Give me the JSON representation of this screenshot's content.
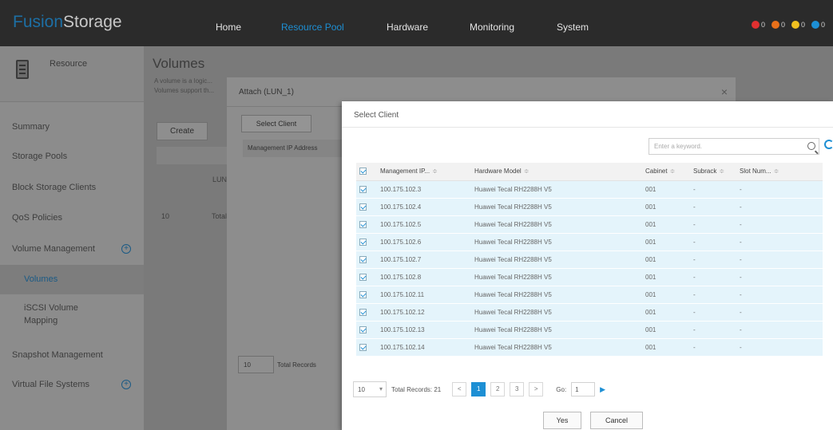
{
  "brand": {
    "logo_part1": "Fusion",
    "logo_part2": "Storage"
  },
  "nav": {
    "items": [
      "Home",
      "Resource Pool",
      "Hardware",
      "Monitoring",
      "System"
    ],
    "active": "Resource Pool"
  },
  "alarms": [
    {
      "color": "#e03030",
      "count": "0"
    },
    {
      "color": "#e8701a",
      "count": "0"
    },
    {
      "color": "#f0c020",
      "count": "0"
    },
    {
      "color": "#1d8fd4",
      "count": "0"
    }
  ],
  "sidebar": {
    "title": "Resource",
    "items": [
      "Summary",
      "Storage Pools",
      "Block Storage Clients",
      "QoS Policies",
      "Volume Management",
      "Volumes",
      "iSCSI Volume",
      "Mapping",
      "Snapshot Management",
      "Virtual File Systems"
    ]
  },
  "main": {
    "title": "Volumes",
    "desc_line1": "A volume is a logic...",
    "desc_line2": "Volumes support th...",
    "create_label": "Create",
    "row_text": "LUN",
    "page_size": "10",
    "total_text": "Total"
  },
  "attach": {
    "title": "Attach (LUN_1)",
    "close": "×",
    "select_client_label": "Select Client",
    "col_header": "Management IP Address",
    "page_size": "10",
    "total_text": "Total Records"
  },
  "client_dialog": {
    "title": "Select Client",
    "search_placeholder": "Enter a keyword.",
    "columns": [
      "Management IP...",
      "Hardware Model",
      "Cabinet",
      "Subrack",
      "Slot Num..."
    ],
    "rows": [
      {
        "ip": "100.175.102.3",
        "model": "Huawei Tecal RH2288H V5",
        "cabinet": "001",
        "subrack": "-",
        "slot": "-"
      },
      {
        "ip": "100.175.102.4",
        "model": "Huawei Tecal RH2288H V5",
        "cabinet": "001",
        "subrack": "-",
        "slot": "-"
      },
      {
        "ip": "100.175.102.5",
        "model": "Huawei Tecal RH2288H V5",
        "cabinet": "001",
        "subrack": "-",
        "slot": "-"
      },
      {
        "ip": "100.175.102.6",
        "model": "Huawei Tecal RH2288H V5",
        "cabinet": "001",
        "subrack": "-",
        "slot": "-"
      },
      {
        "ip": "100.175.102.7",
        "model": "Huawei Tecal RH2288H V5",
        "cabinet": "001",
        "subrack": "-",
        "slot": "-"
      },
      {
        "ip": "100.175.102.8",
        "model": "Huawei Tecal RH2288H V5",
        "cabinet": "001",
        "subrack": "-",
        "slot": "-"
      },
      {
        "ip": "100.175.102.11",
        "model": "Huawei Tecal RH2288H V5",
        "cabinet": "001",
        "subrack": "-",
        "slot": "-"
      },
      {
        "ip": "100.175.102.12",
        "model": "Huawei Tecal RH2288H V5",
        "cabinet": "001",
        "subrack": "-",
        "slot": "-"
      },
      {
        "ip": "100.175.102.13",
        "model": "Huawei Tecal RH2288H V5",
        "cabinet": "001",
        "subrack": "-",
        "slot": "-"
      },
      {
        "ip": "100.175.102.14",
        "model": "Huawei Tecal RH2288H V5",
        "cabinet": "001",
        "subrack": "-",
        "slot": "-"
      }
    ],
    "pager": {
      "page_size": "10",
      "total": "Total Records: 21",
      "pages": [
        "1",
        "2",
        "3"
      ],
      "current": "1",
      "prev": "<",
      "next": ">",
      "go_label": "Go:",
      "go_value": "1",
      "go_arrow": "▶"
    },
    "yes_label": "Yes",
    "cancel_label": "Cancel"
  }
}
